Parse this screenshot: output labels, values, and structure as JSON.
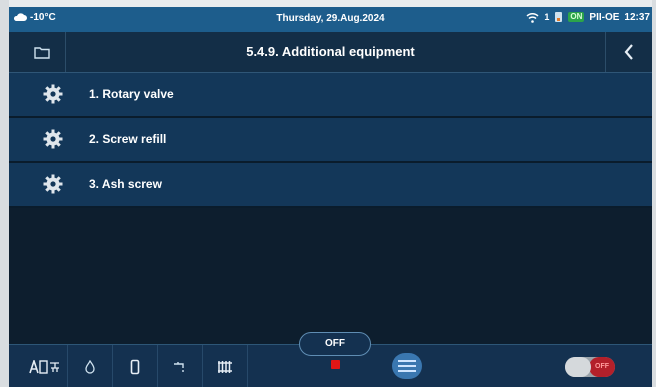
{
  "status_bar": {
    "temperature": "-10°C",
    "date": "Thursday, 29.Aug.2024",
    "signal_count": "1",
    "on_badge": "ON",
    "device_name": "PII-OE",
    "time": "12:37"
  },
  "title_bar": {
    "title": "5.4.9. Additional equipment",
    "left_icon": "folder-icon",
    "back_icon": "chevron-left-icon"
  },
  "menu_items": [
    {
      "label": "1.  Rotary valve",
      "icon": "gear-icon"
    },
    {
      "label": "2.  Screw refill",
      "icon": "gear-icon"
    },
    {
      "label": "3.  Ash screw",
      "icon": "gear-icon"
    }
  ],
  "bottom_bar": {
    "mode_label": "OFF",
    "toggle_label": "OFF",
    "icons": [
      "auto-mode-icon",
      "flame-icon",
      "tank-icon",
      "tap-icon",
      "radiator-icon",
      "menu-icon"
    ]
  },
  "colors": {
    "status_bar": "#1d5d8c",
    "row_background": "#133759",
    "background": "#0d1e2e",
    "red_indicator": "#e01616"
  }
}
